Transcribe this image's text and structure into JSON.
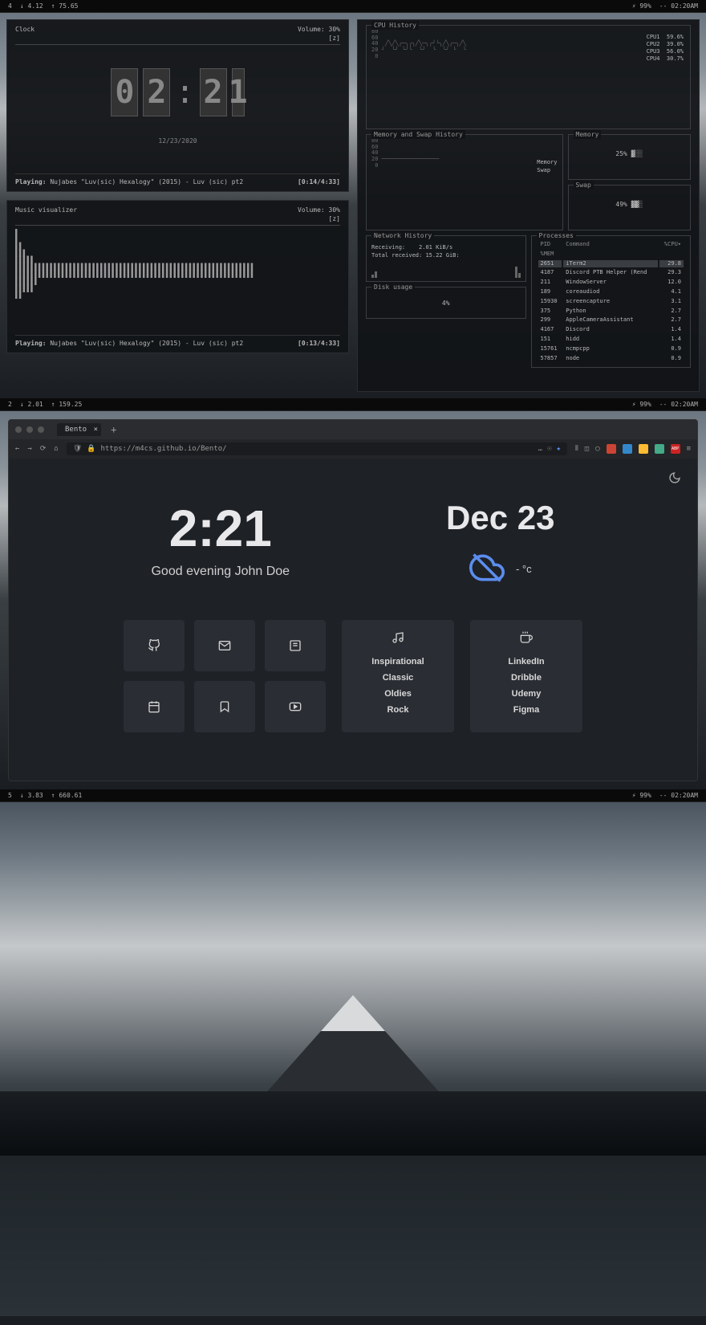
{
  "bars": [
    {
      "ws": "4",
      "net_down": "↓ 4.12",
      "net_up": "↑ 75.65",
      "battery": "⚡ 99%",
      "time": "-- 02:20AM"
    },
    {
      "ws": "2",
      "net_down": "↓ 2.01",
      "net_up": "↑ 159.25",
      "battery": "⚡ 99%",
      "time": "-- 02:20AM"
    },
    {
      "ws": "5",
      "net_down": "↓ 3.83",
      "net_up": "↑ 660.61",
      "battery": "⚡ 99%",
      "time": "-- 02:20AM"
    }
  ],
  "clock_panel": {
    "title": "Clock",
    "volume_label": "Volume: 30%",
    "volume_sub": "[z]",
    "digits": [
      "0",
      "2",
      "2",
      "1"
    ],
    "date": "12/23/2020",
    "playing_label": "Playing:",
    "playing_track": "Nujabes \"Luv(sic) Hexalogy\" (2015) - Luv (sic) pt2",
    "playing_time": "[0:14/4:33]"
  },
  "visualizer_panel": {
    "title": "Music visualizer",
    "volume_label": "Volume: 30%",
    "volume_sub": "[z]",
    "bars": "▌\n▌\n▌▌\n▌▌▌\n▌▌▌▌▌\n▌▌▌▌▌▌▌▌▌▌▌▌▌▌▌▌▌▌▌▌▌▌▌▌▌▌▌▌▌▌▌▌▌▌▌▌▌▌▌▌▌▌▌▌▌▌▌▌▌▌▌▌▌▌▌▌▌▌▌▌▌▌\n▌▌▌▌▌▌▌▌▌▌▌▌▌▌▌▌▌▌▌▌▌▌▌▌▌▌▌▌▌▌▌▌▌▌▌▌▌▌▌▌▌▌▌▌▌▌▌▌▌▌▌▌▌▌▌▌▌▌▌▌▌▌\n▌▌▌▌▌▌\n▌▌▌▌▌\n▌▌",
    "playing_label": "Playing:",
    "playing_track": "Nujabes \"Luv(sic) Hexalogy\" (2015) - Luv (sic) pt2",
    "playing_time": "[0:13/4:33]"
  },
  "cpu_panel": {
    "title": "CPU History",
    "yticks": [
      "80",
      "60",
      "40",
      "20",
      "0"
    ],
    "legend": [
      {
        "label": "CPU1",
        "value": "59.6%"
      },
      {
        "label": "CPU2",
        "value": "39.0%"
      },
      {
        "label": "CPU3",
        "value": "56.0%"
      },
      {
        "label": "CPU4",
        "value": "30.7%"
      }
    ]
  },
  "mem_hist_panel": {
    "title": "Memory and Swap History",
    "yticks": [
      "80",
      "60",
      "40",
      "20",
      "0"
    ],
    "legend": [
      "Memory",
      "Swap"
    ]
  },
  "memory_panel": {
    "title": "Memory",
    "value": "25%"
  },
  "swap_panel": {
    "title": "Swap",
    "value": "49%"
  },
  "network_panel": {
    "title": "Network History",
    "receiving_label": "Receiving:",
    "receiving_value": "2.01 KiB/s",
    "total_label": "Total received:",
    "total_value": "15.22 GiB:"
  },
  "disk_panel": {
    "title": "Disk usage",
    "value": "4%"
  },
  "processes_panel": {
    "title": "Processes",
    "headers": {
      "pid": "PID",
      "cmd": "Command",
      "cpu": "%CPU▾",
      "mem": "%MEM"
    },
    "rows": [
      {
        "pid": "2651",
        "cmd": "iTerm2",
        "cpu": "29.8",
        "hl": true
      },
      {
        "pid": "4187",
        "cmd": "Discord PTB Helper (Rend",
        "cpu": "29.3"
      },
      {
        "pid": "211",
        "cmd": "WindowServer",
        "cpu": "12.0"
      },
      {
        "pid": "189",
        "cmd": "coreaudiod",
        "cpu": "4.1"
      },
      {
        "pid": "15930",
        "cmd": "screencapture",
        "cpu": "3.1"
      },
      {
        "pid": "375",
        "cmd": "Python",
        "cpu": "2.7"
      },
      {
        "pid": "299",
        "cmd": "AppleCameraAssistant",
        "cpu": "2.7"
      },
      {
        "pid": "4167",
        "cmd": "Discord",
        "cpu": "1.4"
      },
      {
        "pid": "151",
        "cmd": "hidd",
        "cpu": "1.4"
      },
      {
        "pid": "15761",
        "cmd": "ncmpcpp",
        "cpu": "0.9"
      },
      {
        "pid": "57857",
        "cmd": "node",
        "cpu": "0.9"
      }
    ]
  },
  "browser": {
    "tab_title": "Bento",
    "url": "https://m4cs.github.io/Bento/",
    "url_indicator": "…",
    "bento": {
      "time": "2:21",
      "greeting": "Good evening John Doe",
      "date": "Dec 23",
      "temp": "- °c",
      "links1": [
        "Inspirational",
        "Classic",
        "Oldies",
        "Rock"
      ],
      "links2": [
        "LinkedIn",
        "Dribble",
        "Udemy",
        "Figma"
      ]
    }
  },
  "chart_data": [
    {
      "type": "line",
      "title": "CPU History",
      "ylabel": "%",
      "ylim": [
        0,
        100
      ],
      "series": [
        {
          "name": "CPU1",
          "current": 59.6
        },
        {
          "name": "CPU2",
          "current": 39.0
        },
        {
          "name": "CPU3",
          "current": 56.0
        },
        {
          "name": "CPU4",
          "current": 30.7
        }
      ]
    },
    {
      "type": "line",
      "title": "Memory and Swap History",
      "ylim": [
        0,
        100
      ],
      "series": [
        {
          "name": "Memory",
          "current": 25
        },
        {
          "name": "Swap",
          "current": 49
        }
      ]
    },
    {
      "type": "bar",
      "title": "Memory",
      "values": [
        25
      ],
      "ylim": [
        0,
        100
      ]
    },
    {
      "type": "bar",
      "title": "Swap",
      "values": [
        49
      ],
      "ylim": [
        0,
        100
      ]
    },
    {
      "type": "bar",
      "title": "Disk usage",
      "values": [
        4
      ],
      "ylim": [
        0,
        100
      ]
    },
    {
      "type": "table",
      "title": "Processes",
      "columns": [
        "PID",
        "Command",
        "%CPU"
      ],
      "rows": [
        [
          "2651",
          "iTerm2",
          29.8
        ],
        [
          "4187",
          "Discord PTB Helper (Rend",
          29.3
        ],
        [
          "211",
          "WindowServer",
          12.0
        ],
        [
          "189",
          "coreaudiod",
          4.1
        ],
        [
          "15930",
          "screencapture",
          3.1
        ],
        [
          "375",
          "Python",
          2.7
        ],
        [
          "299",
          "AppleCameraAssistant",
          2.7
        ],
        [
          "4167",
          "Discord",
          1.4
        ],
        [
          "151",
          "hidd",
          1.4
        ],
        [
          "15761",
          "ncmpcpp",
          0.9
        ],
        [
          "57857",
          "node",
          0.9
        ]
      ]
    }
  ]
}
